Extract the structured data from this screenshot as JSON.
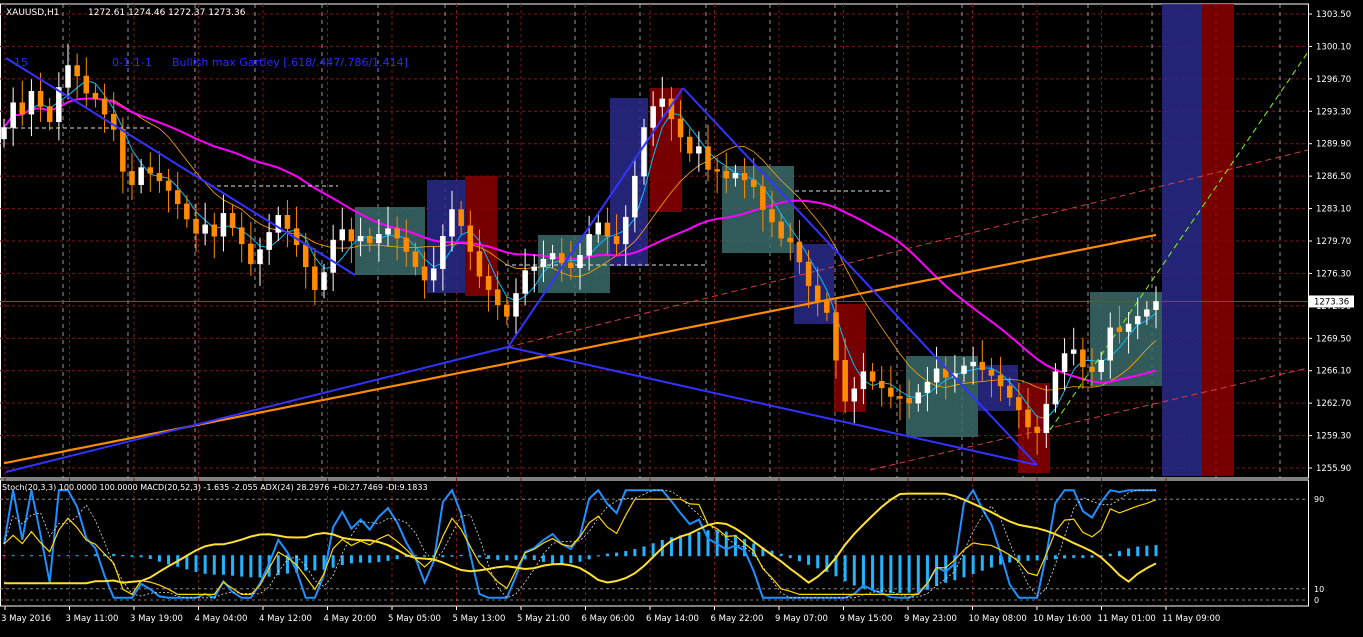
{
  "chart_data": {
    "type": "candlestick",
    "symbol_header": "XAUUSD,H1",
    "ohlc_header": "1272.61 1274.46 1272.37 1273.36",
    "pattern_label": "Bullish max Gartley [.618/.447/.786/1.414]",
    "pattern_tag_1": "15",
    "pattern_tag_2": "0-1-1-1",
    "last_price": "1273.36",
    "y_ticks": [
      "1303.50",
      "1300.10",
      "1296.70",
      "1293.30",
      "1289.90",
      "1286.50",
      "1283.10",
      "1279.70",
      "1276.30",
      "1272.90",
      "1269.50",
      "1266.10",
      "1262.70",
      "1259.30",
      "1255.90"
    ],
    "ylim": [
      1255.9,
      1303.5
    ],
    "x_ticks": [
      "3 May 2016",
      "3 May 11:00",
      "3 May 19:00",
      "4 May 04:00",
      "4 May 12:00",
      "4 May 20:00",
      "5 May 05:00",
      "5 May 13:00",
      "5 May 21:00",
      "6 May 06:00",
      "6 May 14:00",
      "6 May 22:00",
      "9 May 07:00",
      "9 May 15:00",
      "9 May 23:00",
      "10 May 08:00",
      "10 May 16:00",
      "11 May 01:00",
      "11 May 09:00"
    ],
    "closes": [
      1291.6,
      1294.2,
      1293.0,
      1295.4,
      1293.8,
      1292.2,
      1295.8,
      1298.1,
      1297.0,
      1295.2,
      1294.6,
      1293.0,
      1291.4,
      1287.0,
      1285.6,
      1287.4,
      1286.8,
      1286.0,
      1285.0,
      1283.6,
      1282.0,
      1280.5,
      1281.4,
      1280.2,
      1282.6,
      1281.1,
      1279.4,
      1277.3,
      1278.8,
      1280.6,
      1282.4,
      1281.0,
      1279.3,
      1277.0,
      1274.6,
      1276.4,
      1279.8,
      1280.9,
      1279.7,
      1280.2,
      1279.5,
      1280.4,
      1281.0,
      1280.0,
      1278.6,
      1277.0,
      1275.6,
      1276.8,
      1280.2,
      1283.0,
      1281.3,
      1278.6,
      1276.0,
      1274.6,
      1273.0,
      1271.8,
      1274.2,
      1276.6,
      1277.0,
      1277.8,
      1278.4,
      1277.4,
      1276.9,
      1278.2,
      1280.4,
      1281.6,
      1280.2,
      1279.4,
      1282.2,
      1286.5,
      1291.6,
      1293.8,
      1294.6,
      1292.5,
      1290.6,
      1288.9,
      1289.6,
      1287.2,
      1287.0,
      1286.3,
      1286.8,
      1286.1,
      1285.4,
      1283.0,
      1281.7,
      1280.0,
      1279.6,
      1277.5,
      1275.0,
      1273.4,
      1272.2,
      1267.2,
      1262.9,
      1264.2,
      1266.0,
      1265.0,
      1264.3,
      1263.4,
      1263.2,
      1262.7,
      1263.8,
      1264.9,
      1266.3,
      1265.4,
      1265.8,
      1266.6,
      1267.0,
      1266.2,
      1265.6,
      1264.5,
      1263.3,
      1262.0,
      1260.2,
      1259.6,
      1262.6,
      1266.0,
      1267.9,
      1268.3,
      1266.5,
      1266.0,
      1267.2,
      1270.6,
      1270.2,
      1271.0,
      1271.8,
      1272.5,
      1273.36
    ],
    "stats_header": "Stoch(20,3,3) 100.0000 100.0000  MACD(20,52,3) -1.635 -2.055  ADX(24) 28.2976 +DI:27.7469 -DI:9.1833",
    "sub_levels": [
      "90",
      "10",
      "0"
    ]
  }
}
